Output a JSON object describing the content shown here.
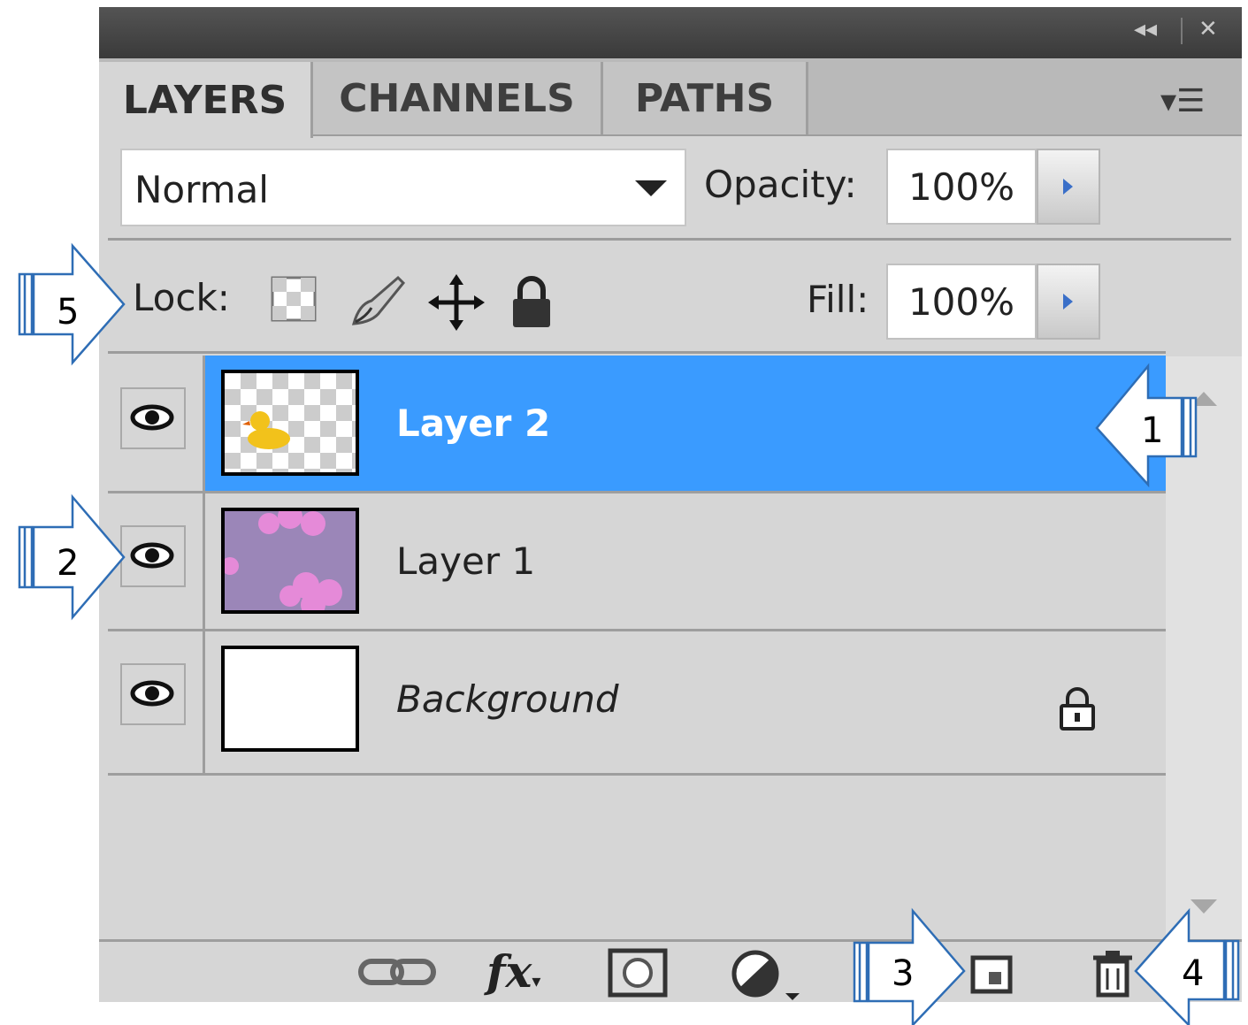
{
  "panel": {
    "title_controls": {
      "collapse_icon": "double-left-chevron-icon",
      "close_icon": "close-icon"
    },
    "tabs": [
      {
        "label": "LAYERS",
        "active": true
      },
      {
        "label": "CHANNELS",
        "active": false
      },
      {
        "label": "PATHS",
        "active": false
      }
    ],
    "menu_icon": "panel-menu-icon"
  },
  "controls": {
    "blend_mode": "Normal",
    "opacity_label": "Opacity:",
    "opacity_value": "100%",
    "lock_label": "Lock:",
    "lock_icons": [
      "lock-transparency-icon",
      "lock-paint-icon",
      "lock-position-icon",
      "lock-all-icon"
    ],
    "fill_label": "Fill:",
    "fill_value": "100%"
  },
  "layers": [
    {
      "name": "Layer 2",
      "selected": true,
      "visible": true,
      "thumb": "duck-on-transparent"
    },
    {
      "name": "Layer 1",
      "selected": false,
      "visible": true,
      "thumb": "purple-flowers"
    },
    {
      "name": "Background",
      "selected": false,
      "visible": true,
      "thumb": "white",
      "locked": true,
      "italic": true
    }
  ],
  "bottom_icons": [
    "link-icon",
    "fx-icon",
    "mask-icon",
    "adjustment-icon",
    "new-layer-icon",
    "trash-icon"
  ],
  "callouts": [
    {
      "number": "1"
    },
    {
      "number": "2"
    },
    {
      "number": "3"
    },
    {
      "number": "4"
    },
    {
      "number": "5"
    }
  ],
  "colors": {
    "selection": "#3a9bff",
    "panel_bg": "#d6d6d6",
    "callout_stroke": "#2e6db5"
  }
}
